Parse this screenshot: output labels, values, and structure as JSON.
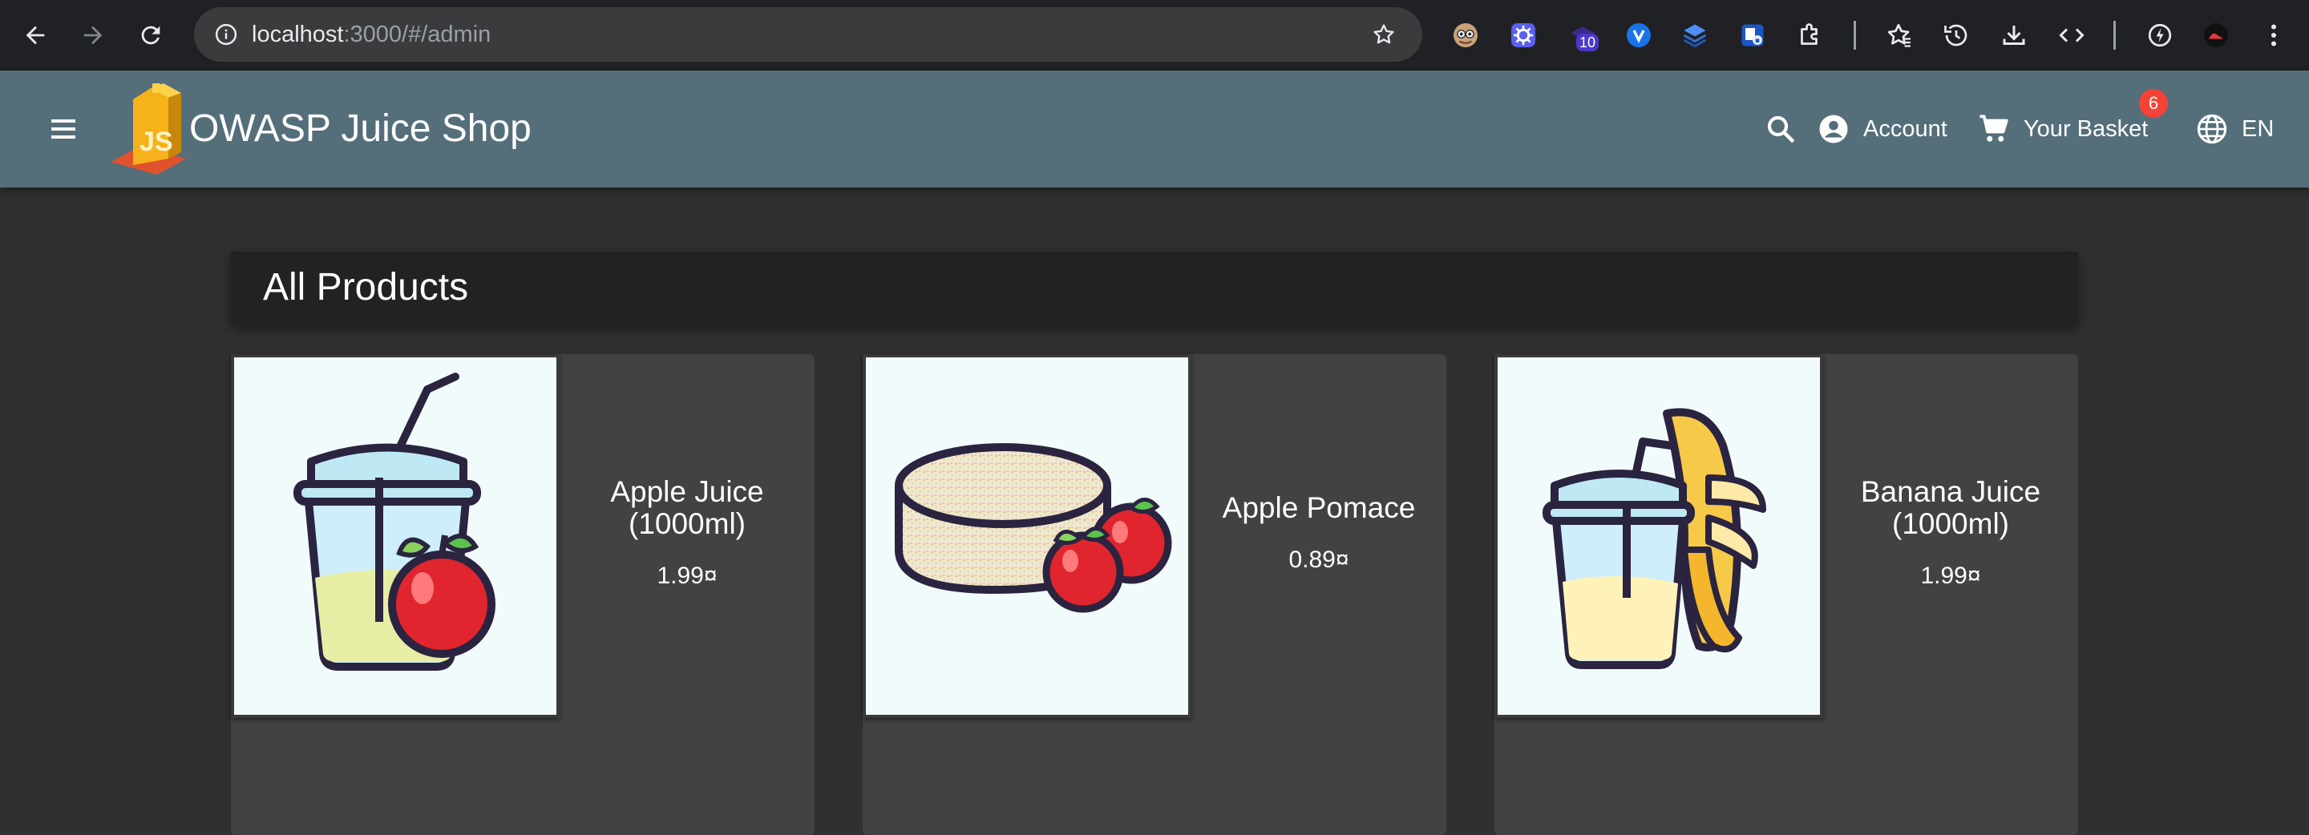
{
  "browser": {
    "url_host": "localhost",
    "url_rest": ":3000/#/admin",
    "extension_badge": "10",
    "icons": [
      "back-icon",
      "forward-icon",
      "reload-icon",
      "site-info-icon",
      "bookmark-star-icon",
      "owl-extension-icon",
      "gear-extension-icon",
      "hat-extension-icon",
      "v-extension-icon",
      "layers-extension-icon",
      "shield-extension-icon",
      "puzzle-extensions-icon",
      "reading-list-icon",
      "history-icon",
      "download-icon",
      "devtools-icon",
      "performance-icon",
      "profile-avatar-icon",
      "more-menu-icon"
    ]
  },
  "app": {
    "title": "OWASP Juice Shop",
    "colors": {
      "toolbar": "#546e7a",
      "background": "#303030",
      "card": "#424242",
      "badge": "#f44336"
    }
  },
  "toolbar": {
    "account_label": "Account",
    "basket_label": "Your Basket",
    "basket_count": "6",
    "language_label": "EN"
  },
  "main": {
    "heading": "All Products",
    "products": [
      {
        "name": "Apple Juice (1000ml)",
        "price": "1.99¤",
        "image": "apple-juice-image"
      },
      {
        "name": "Apple Pomace",
        "price": "0.89¤",
        "image": "apple-pomace-image"
      },
      {
        "name": "Banana Juice (1000ml)",
        "price": "1.99¤",
        "image": "banana-juice-image"
      }
    ]
  }
}
